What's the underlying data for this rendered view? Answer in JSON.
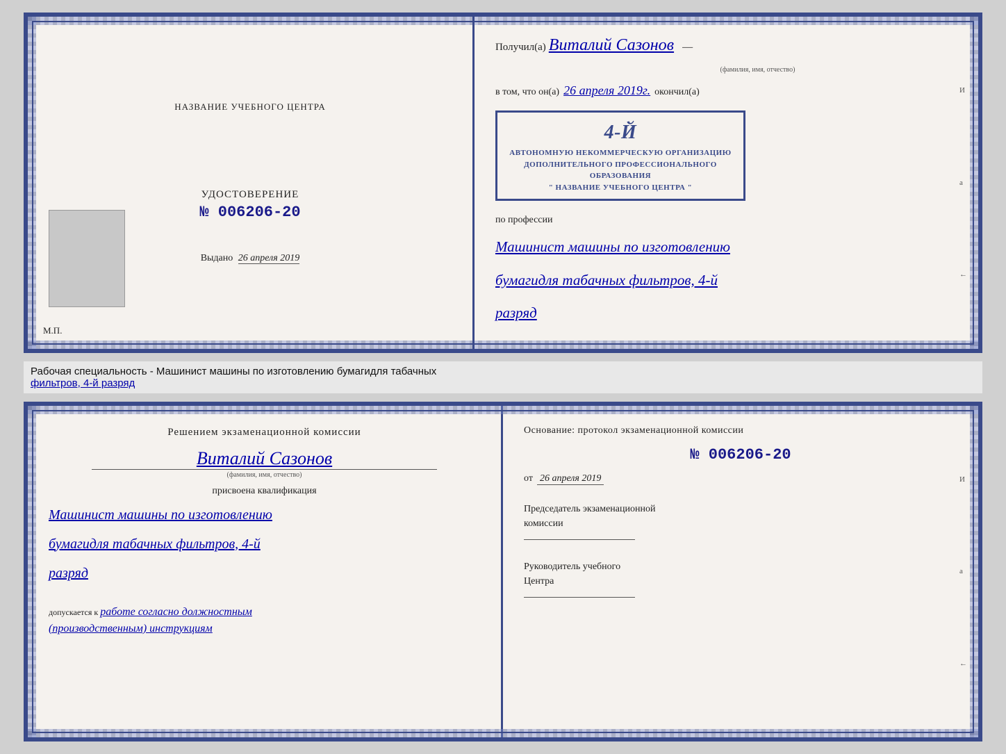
{
  "topCert": {
    "leftSide": {
      "centerTitle": "НАЗВАНИЕ УЧЕБНОГО ЦЕНТРА",
      "udostoverenie": "УДОСТОВЕРЕНИЕ",
      "certNumber": "№ 006206-20",
      "vydano": "Выдано",
      "vydanoDate": "26 апреля 2019",
      "mpLabel": "М.П."
    },
    "rightSide": {
      "poluchilLabel": "Получил(а)",
      "recipientName": "Виталий Сазонов",
      "recipientSubLabel": "(фамилия, имя, отчество)",
      "dashSymbol": "—",
      "vtomLabel": "в том, что он(а)",
      "date": "26 апреля 2019г.",
      "okonchilLabel": "окончил(а)",
      "stampNumber": "4-й",
      "stampLine1": "АВТОНОМНУЮ НЕКОММЕРЧЕСКУЮ ОРГАНИЗАЦИЮ",
      "stampLine2": "ДОПОЛНИТЕЛЬНОГО ПРОФЕССИОНАЛЬНОГО ОБРАЗОВАНИЯ",
      "stampLine3": "\" НАЗВАНИЕ УЧЕБНОГО ЦЕНТРА \"",
      "poProf": "по профессии",
      "profession1": "Машинист машины по изготовлению",
      "profession2": "бумагидля табачных фильтров, 4-й",
      "profession3": "разряд"
    }
  },
  "labelSection": {
    "text": "Рабочая специальность - Машинист машины по изготовлению бумагидля табачных",
    "text2": "фильтров, 4-й разряд"
  },
  "bottomCert": {
    "leftSide": {
      "komissiaTitle": "Решением  экзаменационной  комиссии",
      "recipientName": "Виталий Сазонов",
      "recipientSubLabel": "(фамилия, имя, отчество)",
      "prisvoenaLabel": "присвоена квалификация",
      "qualification1": "Машинист машины по изготовлению",
      "qualification2": "бумагидля табачных фильтров, 4-й",
      "qualification3": "разряд",
      "dopuskaetsya": "допускается к",
      "dopWork": "работе согласно должностным",
      "dopWork2": "(производственным) инструкциям"
    },
    "rightSide": {
      "osnovanye": "Основание: протокол экзаменационной  комиссии",
      "protocolNumber": "№  006206-20",
      "otLabel": "от",
      "otDate": "26 апреля 2019",
      "predsedatelLabel": "Председатель экзаменационной",
      "predsedatelLabel2": "комиссии",
      "rukovoditelLabel": "Руководитель учебного",
      "rukovoditelLabel2": "Центра"
    }
  },
  "sideMarks": {
    "mark1": "И",
    "mark2": "а",
    "mark3": "←"
  }
}
